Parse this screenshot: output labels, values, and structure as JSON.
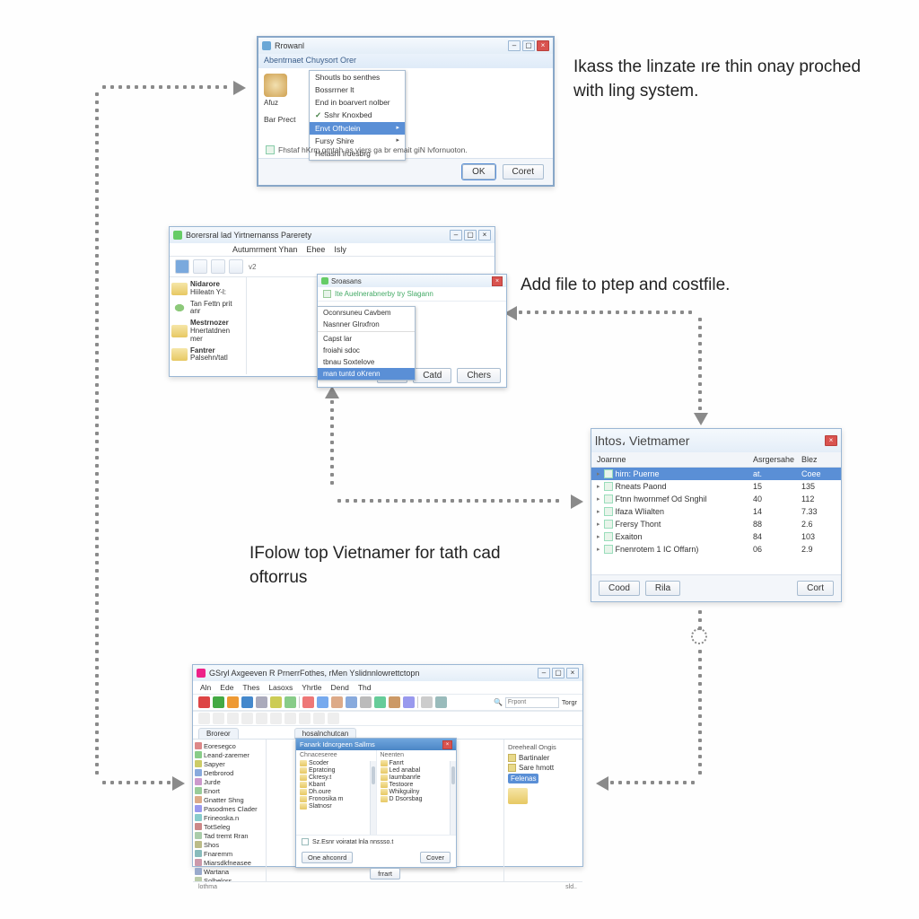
{
  "captions": {
    "c1": "Ikass the linzate ıre thin onay proched with ling system.",
    "c2": "Add file to ptep and costfile.",
    "c3": "IFolow top Vietnamer for tath cad oftorrus"
  },
  "winA": {
    "title": "Rrowanl",
    "band": "Abentrnaet Chuysort Orer",
    "wizard_label": "Afuz",
    "side_label": "Bar Prect",
    "menu": {
      "m1": "Shoutls bo senthes",
      "m2": "Bossrrner lt",
      "m3": "End in boarvert nolber",
      "m4": "Sshr Knoxbed",
      "m5": "Envt Ofhclein",
      "m6": "Fursy Shire",
      "m7": "Helashl Iruesbrg"
    },
    "note": "Fhstaf hKrm omtah as viers ga br emait giN lvfornuoton.",
    "ok": "OK",
    "cancel": "Coret"
  },
  "winB": {
    "title": "Borersral lad Yirtnernanss Parerety",
    "menubar": {
      "m1": "Autumrment Yhan",
      "m2": "Ehee",
      "m3": "Isly"
    },
    "side": {
      "s1": {
        "t1": "Nidarore",
        "t2": "Hiileatn Y-l:"
      },
      "s2": {
        "t1": "Tan Fettn prit anr"
      },
      "s3": {
        "t1": "Mestrnozer",
        "t2": "Hnertatdnen mer"
      },
      "s4": {
        "t1": "Fantrer",
        "t2": "Palsehn/tatl"
      }
    },
    "sub": {
      "title": "Sroasans",
      "bar": "Ite Auelnerabnerby try Slagann",
      "ok": "oK",
      "cancel": "Catd",
      "close": "Chers"
    },
    "ctx": {
      "m1": "Oconrsuneu Cavbem",
      "m2": "Nasnner Glnxfron",
      "m3": "Capst lar",
      "m4": "froiahi sdoc",
      "m5": "tbnau Soxtelove",
      "m6": "man tuntd oKrenn"
    }
  },
  "winC": {
    "title": "lhtos، Vietmamer",
    "cols": {
      "c1": "Joarnne",
      "c2": "Asrgersahe",
      "c3": "Blez"
    },
    "rows": [
      {
        "n": "hirn: Puerne",
        "a": "at.",
        "b": "Coee"
      },
      {
        "n": "Rneats Paond",
        "a": "15",
        "b": "135"
      },
      {
        "n": "Ftnn hwornmef Od Snghil",
        "a": "40",
        "b": "112"
      },
      {
        "n": "Ifaza WIialten",
        "a": "14",
        "b": "7.33"
      },
      {
        "n": "Frersy Thont",
        "a": "88",
        "b": "2.6"
      },
      {
        "n": "Exaiton",
        "a": "84",
        "b": "103"
      },
      {
        "n": "Fnenrotem 1 IC Offarn)",
        "a": "06",
        "b": "2.9"
      }
    ],
    "btns": {
      "b1": "Cood",
      "b2": "Rila",
      "b3": "Cort"
    }
  },
  "winD": {
    "title": "GSryl Axgeeven R PrnerrFothes, rMen Yslidnnlowrettctopn",
    "menubar": {
      "m1": "Aln",
      "m2": "Ede",
      "m3": "Thes",
      "m4": "Lasoxs",
      "m5": "Yhrtle",
      "m6": "Dend",
      "m7": "Thd"
    },
    "search": {
      "label": "Frpont",
      "go": "Torgr"
    },
    "tabs": {
      "t1": "Broreor",
      "t2": "hosalnchutcan"
    },
    "tree": [
      "Eoresegco",
      "Leand-zaremer",
      "Sapyer",
      "Detbrorod",
      "Jurde",
      "Enort",
      "Gnatter Shng",
      "Pasodmes Clader",
      "Frineoska.n",
      "TotSeleg",
      "Tad tremt Rran",
      "Shos",
      "Fnaremm",
      "Miarsdkfneasee",
      "Wartana",
      "Solbelors"
    ],
    "right": {
      "h": "Dreeheall Ongis",
      "r1": "Bartinaler",
      "r2": "Sare hmott",
      "r3": "Felenas"
    },
    "dlg": {
      "title": "Fanark Idncrgeen Sallrns",
      "h1": "Chnaceseree",
      "h2": "Neenten",
      "col1": [
        "Scoder",
        "Epratcing",
        "Ckresy.t",
        "Kbant",
        "Dh.oure",
        "Fronosika m",
        "Slatnosr"
      ],
      "col2": [
        "Fanrt",
        "Led anabal",
        "Iaumbanrle",
        "Testoore",
        "Whikguilny",
        "D Dsorsbag"
      ],
      "chk": "Sz.Esnr voiratat lnla nnssso.t",
      "b1": "One ahconrd",
      "b2": "Cover"
    },
    "footerbtn": "frrart",
    "status": {
      "left": "lothma",
      "right": "sld.."
    }
  }
}
